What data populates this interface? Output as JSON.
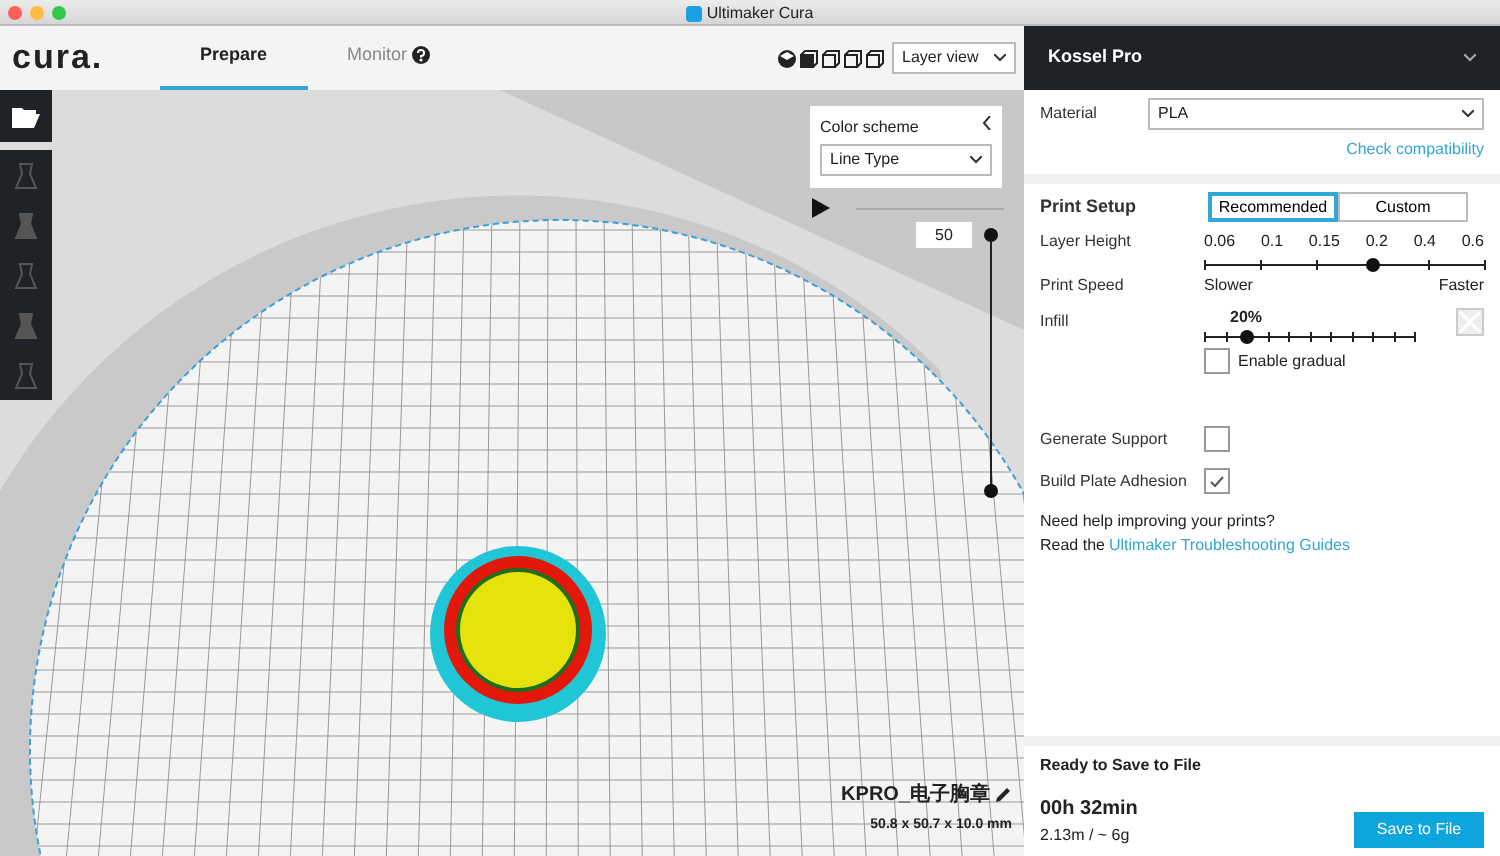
{
  "window": {
    "title": "Ultimaker Cura"
  },
  "header": {
    "logo": "cura.",
    "tabs": [
      {
        "label": "Prepare",
        "selected": true,
        "help": false
      },
      {
        "label": "Monitor",
        "selected": false,
        "help": true
      }
    ],
    "view_mode": "Layer view"
  },
  "layer_panel": {
    "title": "Color scheme",
    "scheme": "Line Type",
    "layer": "50"
  },
  "object": {
    "name": "KPRO_电子胸章",
    "dimensions": "50.8 x 50.7 x 10.0 mm"
  },
  "sidebar": {
    "printer": "Kossel Pro",
    "material_label": "Material",
    "material": "PLA",
    "compat_link": "Check compatibility",
    "setup_title": "Print Setup",
    "modes": [
      {
        "label": "Recommended",
        "selected": true
      },
      {
        "label": "Custom",
        "selected": false
      }
    ],
    "layer_height": {
      "label": "Layer Height",
      "ticks": [
        "0.06",
        "0.1",
        "0.15",
        "0.2",
        "0.4",
        "0.6"
      ],
      "level": 0.6
    },
    "print_speed": {
      "label": "Print Speed",
      "low": "Slower",
      "high": "Faster"
    },
    "infill": {
      "label": "Infill",
      "value": "20%",
      "level": 0.2
    },
    "checks": [
      {
        "label": "Enable gradual",
        "checked": false,
        "kind": "inline"
      },
      {
        "label": "Generate Support",
        "checked": false,
        "kind": "row"
      },
      {
        "label": "Build Plate Adhesion",
        "checked": true,
        "kind": "row"
      }
    ],
    "help_text": "Need help improving your prints?",
    "help_prefix": "Read the",
    "help_link": "Ultimaker Troubleshooting Guides"
  },
  "status": {
    "title": "Ready to Save to File",
    "time": "00h 32min",
    "usage": "2.13m / ~ 6g",
    "button": "Save to File"
  }
}
